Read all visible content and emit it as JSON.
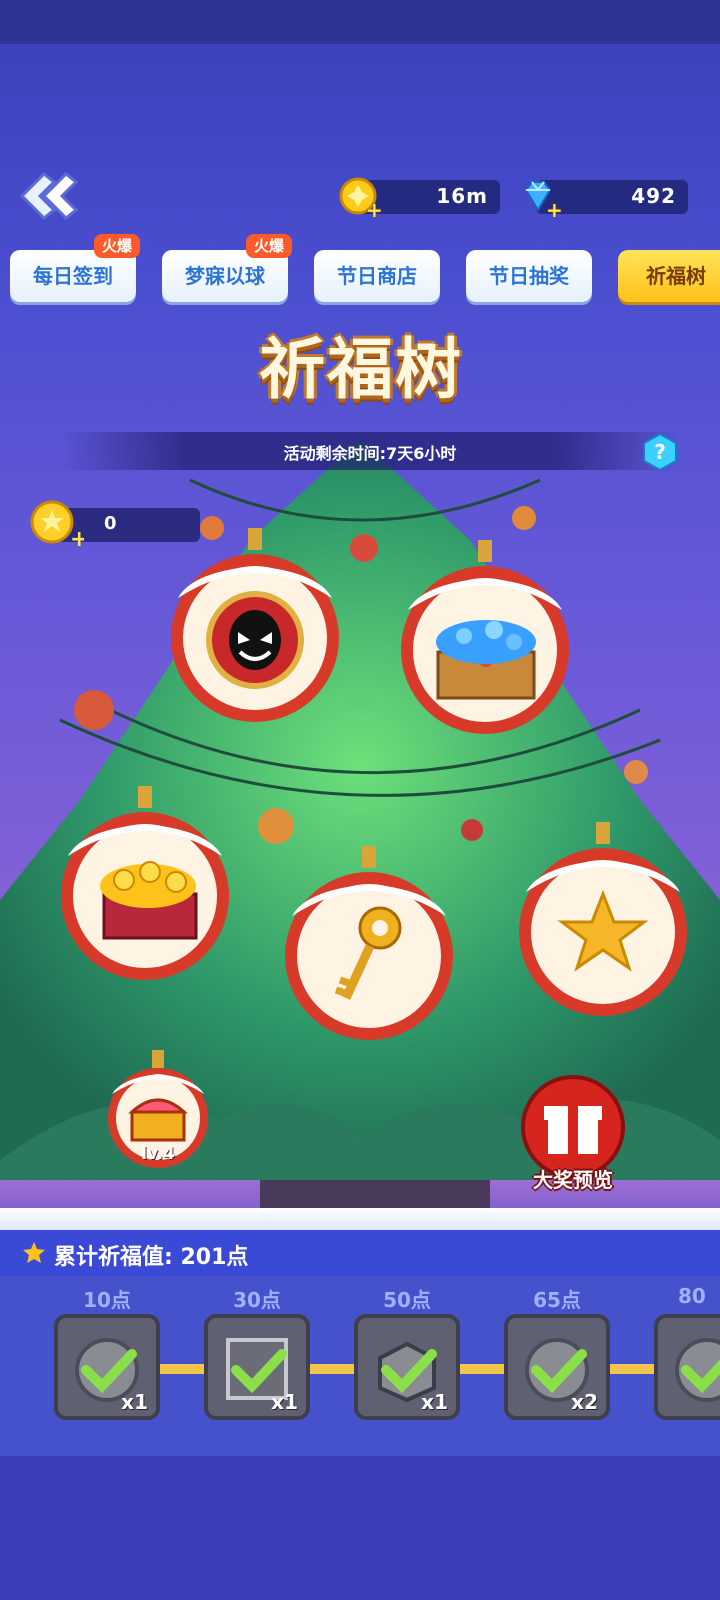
{
  "header": {
    "coins": "16m",
    "gems": "492"
  },
  "tabs": [
    {
      "label": "每日签到",
      "badge": "火爆",
      "active": false
    },
    {
      "label": "梦寐以球",
      "badge": "火爆",
      "active": false
    },
    {
      "label": "节日商店",
      "badge": "",
      "active": false
    },
    {
      "label": "节日抽奖",
      "badge": "",
      "active": false
    },
    {
      "label": "祈福树",
      "badge": "",
      "active": true
    }
  ],
  "event": {
    "title": "祈福树",
    "timer": "活动剩余时间:7天6小时",
    "help": "?",
    "bless_count": "0"
  },
  "ornaments": [
    {
      "item": "venom-medal-icon"
    },
    {
      "item": "gem-chest-icon"
    },
    {
      "item": "gold-coin-chest-icon"
    },
    {
      "item": "golden-key-icon"
    },
    {
      "item": "gold-star-icon"
    }
  ],
  "small_ornament": {
    "level_label": "lv.4",
    "item": "treasure-chest-icon"
  },
  "grand_prize": {
    "label": "大奖预览"
  },
  "cumulative": {
    "text": "累计祈福值: 201点"
  },
  "milestones": [
    {
      "points": "10点",
      "qty": "x1",
      "claimed": true
    },
    {
      "points": "30点",
      "qty": "x1",
      "claimed": true
    },
    {
      "points": "50点",
      "qty": "x1",
      "claimed": true
    },
    {
      "points": "65点",
      "qty": "x2",
      "claimed": true
    },
    {
      "points": "80",
      "qty": "",
      "claimed": true
    }
  ],
  "colors": {
    "tab_active": "#ffc21a",
    "tab_text": "#2b74d6",
    "hot_badge": "#ff5a2a",
    "check": "#8be04a"
  }
}
